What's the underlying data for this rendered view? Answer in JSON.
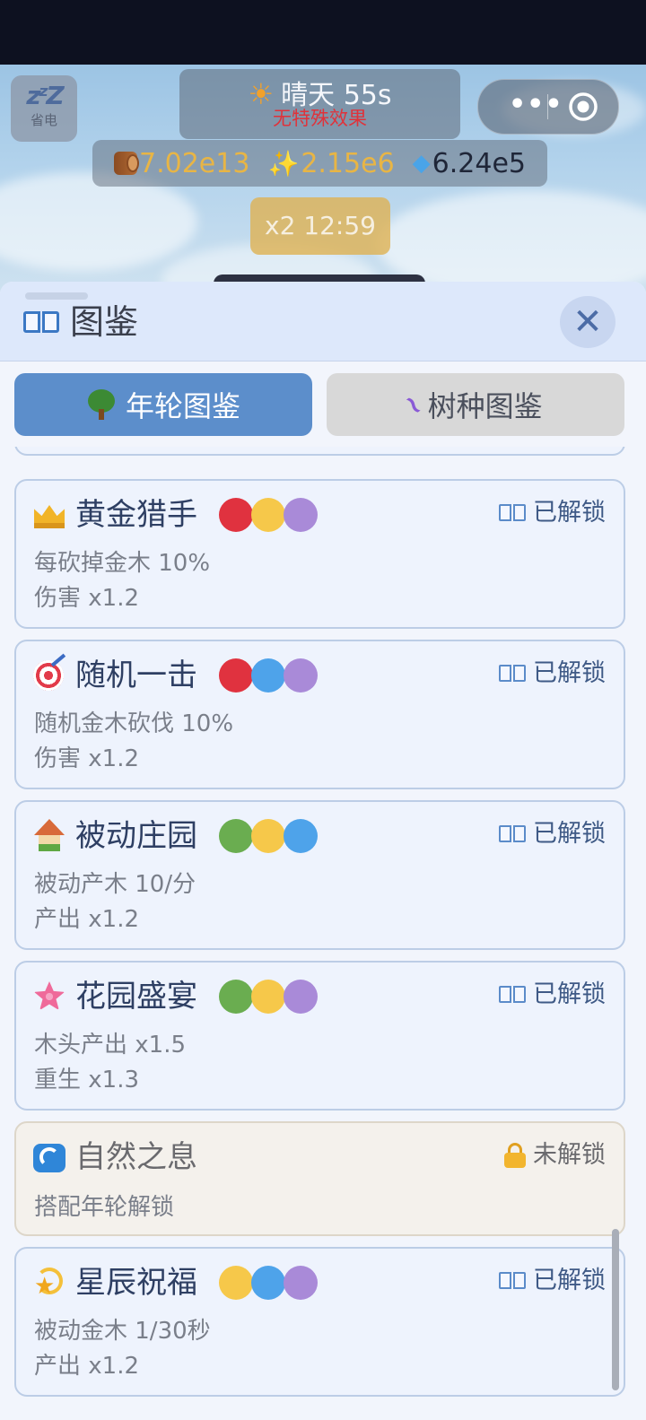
{
  "hud": {
    "sleep_label": "省电",
    "weather": {
      "icon": "sun-icon",
      "text": "晴天 55s",
      "effect": "无特殊效果"
    },
    "resources": [
      {
        "icon": "wood-log-icon",
        "value": "7.02e13",
        "color": "#e8b545"
      },
      {
        "icon": "sparkles-icon",
        "value": "2.15e6",
        "color": "#e8b545"
      },
      {
        "icon": "gem-icon",
        "value": "6.24e5",
        "color": "#1f2638"
      }
    ],
    "boost": "x2 12:59"
  },
  "panel": {
    "title": "图鉴",
    "tabs": [
      {
        "label": "年轮图鉴",
        "icon": "tree-icon",
        "active": true
      },
      {
        "label": "树种图鉴",
        "icon": "dna-icon",
        "active": false
      }
    ]
  },
  "entries": [
    {
      "icon": "crown-icon",
      "title": "黄金猎手",
      "dots": [
        "#e0323f",
        "#f6c84a",
        "#a98ad8"
      ],
      "status": "已解锁",
      "desc1": "每砍掉金木 10%",
      "desc2": "伤害 x1.2"
    },
    {
      "icon": "target-icon",
      "title": "随机一击",
      "dots": [
        "#e0323f",
        "#4ea3ea",
        "#a98ad8"
      ],
      "status": "已解锁",
      "desc1": "随机金木砍伐 10%",
      "desc2": "伤害 x1.2"
    },
    {
      "icon": "house-garden-icon",
      "title": "被动庄园",
      "dots": [
        "#6aad50",
        "#f6c84a",
        "#4ea3ea"
      ],
      "status": "已解锁",
      "desc1": "被动产木 10/分",
      "desc2": "产出 x1.2"
    },
    {
      "icon": "hibiscus-icon",
      "title": "花园盛宴",
      "dots": [
        "#6aad50",
        "#f6c84a",
        "#a98ad8"
      ],
      "status": "已解锁",
      "desc1": "木头产出 x1.5",
      "desc2": "重生 x1.3"
    },
    {
      "icon": "wave-icon",
      "title": "自然之息",
      "status": "未解锁",
      "locked": true,
      "desc1": "搭配年轮解锁"
    },
    {
      "icon": "dizzy-star-icon",
      "title": "星辰祝福",
      "dots": [
        "#f6c84a",
        "#4ea3ea",
        "#a98ad8"
      ],
      "status": "已解锁",
      "desc1": "被动金木 1/30秒",
      "desc2": "产出 x1.2"
    }
  ]
}
